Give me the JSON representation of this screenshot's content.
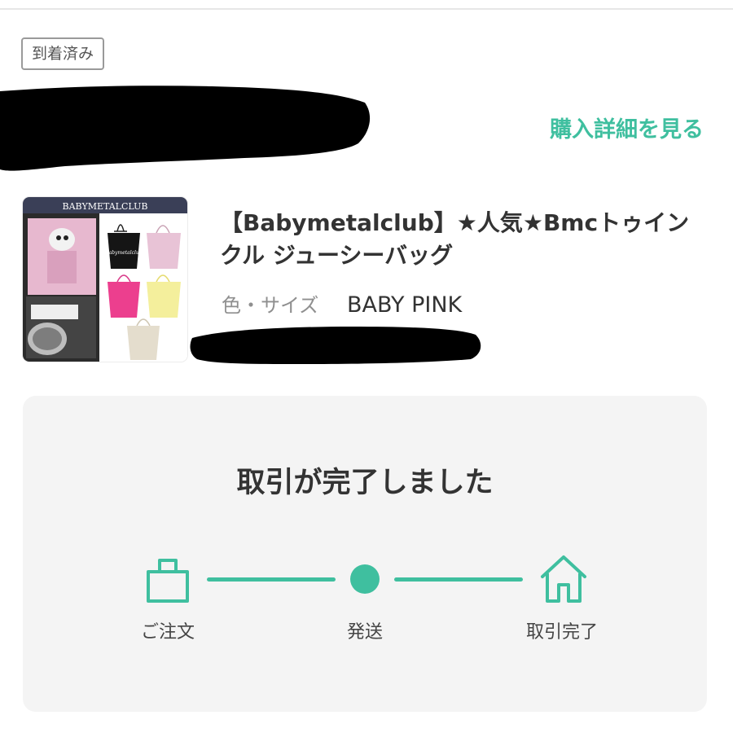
{
  "status": {
    "badge": "到着済み"
  },
  "header": {
    "purchase_details_link": "購入詳細を見る"
  },
  "product": {
    "title": "【Babymetalclub】★人気★Bmcトゥインクル ジューシーバッグ",
    "variant_label": "色・サイズ",
    "variant_value": "BABY PINK",
    "thumbnail_banner": "BABYMETALCLUB",
    "thumbnail_bag_script": "Babymetalclub"
  },
  "progress": {
    "title": "取引が完了しました",
    "steps": [
      {
        "label": "ご注文",
        "icon": "shopping-bag-icon"
      },
      {
        "label": "発送",
        "icon": "dot-icon"
      },
      {
        "label": "取引完了",
        "icon": "house-icon"
      }
    ]
  },
  "colors": {
    "accent": "#3fbf9f",
    "panel_bg": "#f4f4f4",
    "text": "#333333",
    "muted": "#8f8f8f",
    "redaction": "#000000"
  }
}
